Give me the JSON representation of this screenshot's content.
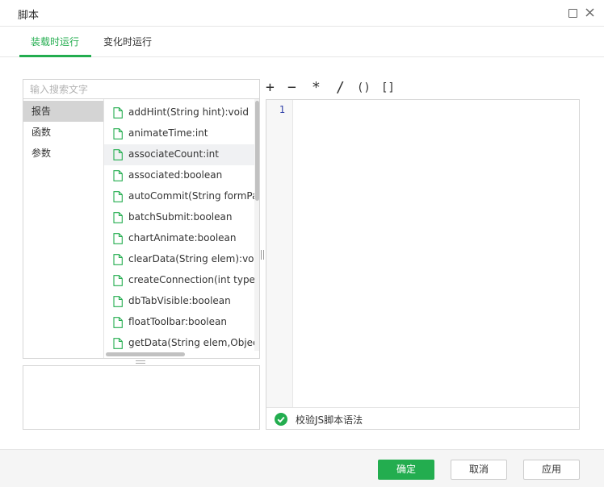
{
  "window": {
    "title": "脚本",
    "maximize_icon": "maximize-icon",
    "close_icon": "close-icon"
  },
  "tabs": [
    {
      "label": "装载时运行",
      "active": true
    },
    {
      "label": "变化时运行",
      "active": false
    }
  ],
  "colors": {
    "accent": "#23ad4f",
    "selected_category": "#d4d4d4",
    "line_number": "#3344aa"
  },
  "search": {
    "placeholder": "输入搜索文字",
    "value": ""
  },
  "categories": [
    {
      "label": "报告",
      "selected": true
    },
    {
      "label": "函数",
      "selected": false
    },
    {
      "label": "参数",
      "selected": false
    }
  ],
  "functions": [
    {
      "label": "addHint(String hint):void",
      "icon": "file-icon"
    },
    {
      "label": "animateTime:int",
      "icon": "file-icon"
    },
    {
      "label": "associateCount:int",
      "icon": "file-icon",
      "hovered": true
    },
    {
      "label": "associated:boolean",
      "icon": "file-icon"
    },
    {
      "label": "autoCommit(String formParm",
      "icon": "file-icon"
    },
    {
      "label": "batchSubmit:boolean",
      "icon": "file-icon"
    },
    {
      "label": "chartAnimate:boolean",
      "icon": "file-icon"
    },
    {
      "label": "clearData(String elem):void",
      "icon": "file-icon"
    },
    {
      "label": "createConnection(int type,Str",
      "icon": "file-icon"
    },
    {
      "label": "dbTabVisible:boolean",
      "icon": "file-icon"
    },
    {
      "label": "floatToolbar:boolean",
      "icon": "file-icon"
    },
    {
      "label": "getData(String elem,Object o",
      "icon": "file-icon"
    }
  ],
  "operators": [
    "+",
    "−",
    "*",
    "/",
    "()",
    "[]"
  ],
  "editor": {
    "line_numbers": [
      "1"
    ],
    "content": ""
  },
  "validate": {
    "label": "校验JS脚本语法",
    "icon": "check-circle-icon"
  },
  "footer": {
    "ok_label": "确定",
    "cancel_label": "取消",
    "apply_label": "应用"
  }
}
